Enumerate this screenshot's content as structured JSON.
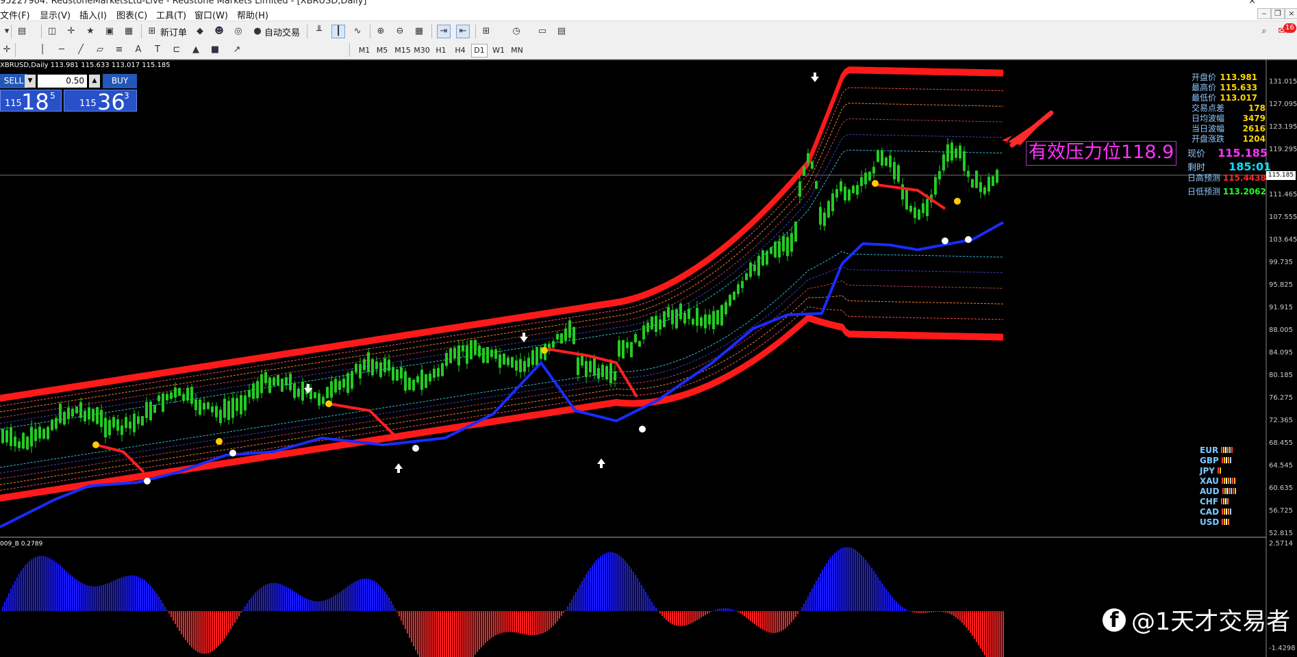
{
  "window": {
    "title": "95227904: RedstoneMarketsLtd-Live - Redstone Markets Limited - [XBRUSD,Daily]",
    "close_glyph": "×"
  },
  "menu": {
    "file": "文件(F)",
    "view": "显示(V)",
    "insert": "插入(I)",
    "chart": "图表(C)",
    "tools": "工具(T)",
    "window": "窗口(W)",
    "help": "帮助(H)"
  },
  "toolbar": {
    "new_order": "新订单",
    "auto_trade": "自动交易",
    "notification_count": "16",
    "timeframes": [
      "M1",
      "M5",
      "M15",
      "M30",
      "H1",
      "H4",
      "D1",
      "W1",
      "MN"
    ],
    "active_timeframe": "D1"
  },
  "chart": {
    "symbol_line": "XBRUSD,Daily  113.981 115.633 113.017 115.185",
    "current_price": "115.185",
    "price_ticks": [
      "131.015",
      "127.095",
      "123.195",
      "119.295",
      "115.185",
      "111.465",
      "107.555",
      "103.645",
      "99.735",
      "95.825",
      "91.915",
      "88.005",
      "84.095",
      "80.185",
      "76.275",
      "72.365",
      "68.455",
      "64.545",
      "60.635",
      "56.725",
      "52.815"
    ],
    "indicator_label": "009_B 0.2789",
    "indicator_ticks": [
      "2.5714",
      "-1.4298"
    ],
    "colors": {
      "upper_band": "#ff1a1a",
      "lower_band": "#ff1a1a",
      "trend_line": "#1a2cff",
      "candle": "#22cc22",
      "hist_pos": "#1a1aff",
      "hist_neg": "#ff2020"
    }
  },
  "trade_panel": {
    "sell_label": "SELL",
    "buy_label": "BUY",
    "lot": "0.50",
    "sell_pre": "115",
    "sell_big": "18",
    "sell_sup": "5",
    "buy_pre": "115",
    "buy_big": "36",
    "buy_sup": "3"
  },
  "info_panel": {
    "rows": [
      {
        "label": "开盘价",
        "value": "113.981"
      },
      {
        "label": "最高价",
        "value": "115.633"
      },
      {
        "label": "最低价",
        "value": "113.017"
      },
      {
        "label": "交易点差",
        "value": "178"
      },
      {
        "label": "日均波幅",
        "value": "3479"
      },
      {
        "label": "当日波幅",
        "value": "2616"
      },
      {
        "label": "开盘涨跌",
        "value": "1204"
      }
    ],
    "now_label": "现价",
    "now_value": "115.185",
    "countdown_label": "剩时",
    "countdown_value": "185:01",
    "high_forecast_label": "日高预测",
    "high_forecast_value": "115.4438",
    "low_forecast_label": "日低预测",
    "low_forecast_value": "113.2062"
  },
  "annotation": {
    "text": "有效压力位118.9",
    "color": "#ff33ff"
  },
  "currency_strength": [
    "EUR",
    "GBP",
    "JPY",
    "XAU",
    "AUD",
    "CHF",
    "CAD",
    "USD"
  ],
  "watermark": {
    "icon": "f",
    "text": "@1天才交易者"
  }
}
